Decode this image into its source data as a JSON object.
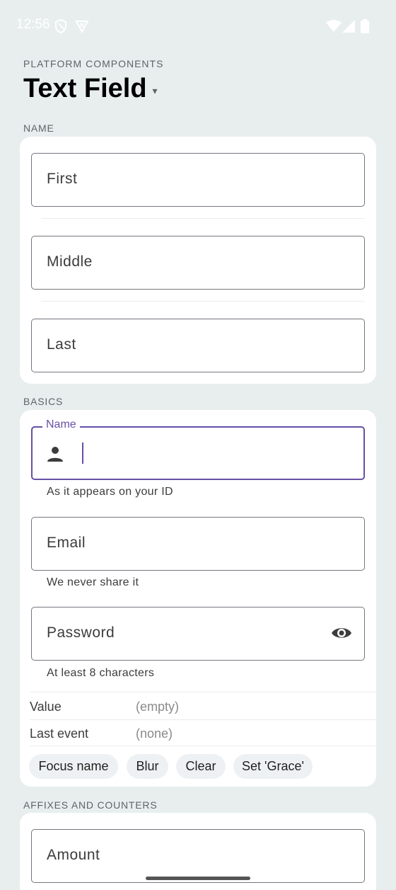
{
  "status_bar": {
    "time": "12:56",
    "icons": [
      "shield-icon",
      "vpn-icon",
      "wifi-icon",
      "signal-icon",
      "battery-icon"
    ]
  },
  "header": {
    "eyebrow": "PLATFORM COMPONENTS",
    "title": "Text Field",
    "caret": "▾"
  },
  "sections": {
    "name": {
      "label": "NAME",
      "fields": [
        {
          "label": "First"
        },
        {
          "label": "Middle"
        },
        {
          "label": "Last"
        }
      ]
    },
    "basics": {
      "label": "BASICS",
      "name_field": {
        "label": "Name",
        "supporting": "As it appears on your ID",
        "icon": "person-icon"
      },
      "email_field": {
        "label": "Email",
        "supporting": "We never share it"
      },
      "password_field": {
        "label": "Password",
        "supporting": "At least 8 characters",
        "icon": "eye-icon"
      },
      "rows": [
        {
          "key": "Value",
          "value": "(empty)"
        },
        {
          "key": "Last event",
          "value": "(none)"
        }
      ],
      "chips": [
        "Focus name",
        "Blur",
        "Clear",
        "Set 'Grace'"
      ]
    },
    "affixes": {
      "label": "AFFIXES AND COUNTERS",
      "amount_field": {
        "label": "Amount"
      }
    }
  },
  "colors": {
    "background": "#e8eeee",
    "accent": "#6750a4",
    "outline": "#79747e"
  }
}
